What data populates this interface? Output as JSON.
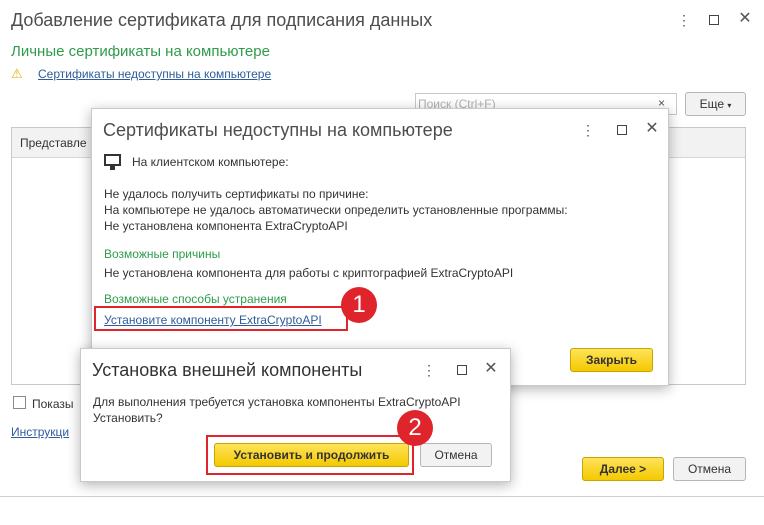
{
  "main": {
    "title": "Добавление сертификата для подписания данных",
    "section_title": "Личные сертификаты на компьютере",
    "warning_link": "Сертификаты недоступны на компьютере",
    "search_placeholder": "Поиск (Ctrl+F)",
    "more_label": "Еще",
    "column_header": "Представле",
    "checkbox_label": "Показы",
    "instructions_link": "Инструкци",
    "next_button": "Далее >",
    "cancel_button": "Отмена"
  },
  "cert_dialog": {
    "title": "Сертификаты недоступны на компьютере",
    "client_label": "На клиентском компьютере:",
    "message_lines": [
      "Не удалось получить сертификаты по причине:",
      "На компьютере не удалось автоматически определить установленные программы:",
      "Не установлена компонента ExtraCryptoAPI"
    ],
    "reasons_title": "Возможные причины",
    "reason_text": "Не установлена компонента для работы с криптографией ExtraCryptoAPI",
    "fixes_title": "Возможные способы устранения",
    "fix_link": "Установите компоненту ExtraCryptoAPI",
    "close_button": "Закрыть"
  },
  "install_dialog": {
    "title": "Установка внешней компоненты",
    "message_lines": [
      "Для выполнения требуется установка компоненты ExtraCryptoAPI",
      "Установить?"
    ],
    "install_button": "Установить и продолжить",
    "cancel_button": "Отмена"
  },
  "annotations": {
    "badge1": "1",
    "badge2": "2"
  },
  "colors": {
    "accent_green": "#2e9c4a",
    "link_blue": "#2e5c9a",
    "highlight_red": "#e0242c",
    "button_yellow": "#f4c900"
  }
}
